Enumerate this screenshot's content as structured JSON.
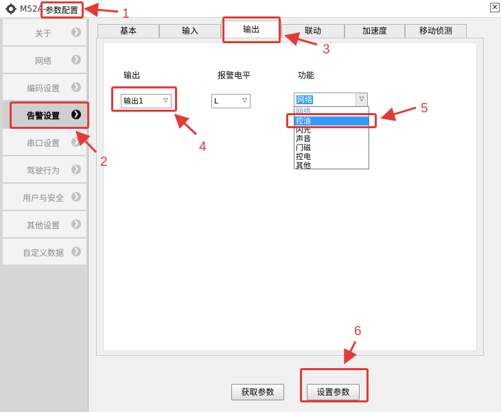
{
  "window": {
    "app_name": "M52A",
    "separator": "-",
    "title": "参数配置",
    "close_icon": "close-icon"
  },
  "sidebar": {
    "items": [
      {
        "label": "关于",
        "active": false
      },
      {
        "label": "网络",
        "active": false
      },
      {
        "label": "编码设置",
        "active": false
      },
      {
        "label": "告警设置",
        "active": true
      },
      {
        "label": "串口设置",
        "active": false
      },
      {
        "label": "驾驶行为",
        "active": false
      },
      {
        "label": "用户与安全",
        "active": false
      },
      {
        "label": "其他设置",
        "active": false
      },
      {
        "label": "自定义数据",
        "active": false
      }
    ],
    "chevron": "❯"
  },
  "tabs": [
    "基本",
    "输入",
    "输出",
    "联动",
    "加速度",
    "移动侦测"
  ],
  "active_tab": "输出",
  "form": {
    "output_header": "输出",
    "alarm_level_header": "报警电平",
    "function_header": "功能",
    "output_value": "输出1",
    "alarm_level_value": "L",
    "function_value": "网络",
    "function_options": [
      "网络",
      "控油",
      "闪光",
      "声音",
      "门磁",
      "控电",
      "其他"
    ],
    "highlighted_option": "控油"
  },
  "buttons": {
    "get_params": "获取参数",
    "set_params": "设置参数"
  },
  "annotations": {
    "color": "#e53935",
    "numbers": [
      "1",
      "2",
      "3",
      "4",
      "5",
      "6"
    ]
  }
}
